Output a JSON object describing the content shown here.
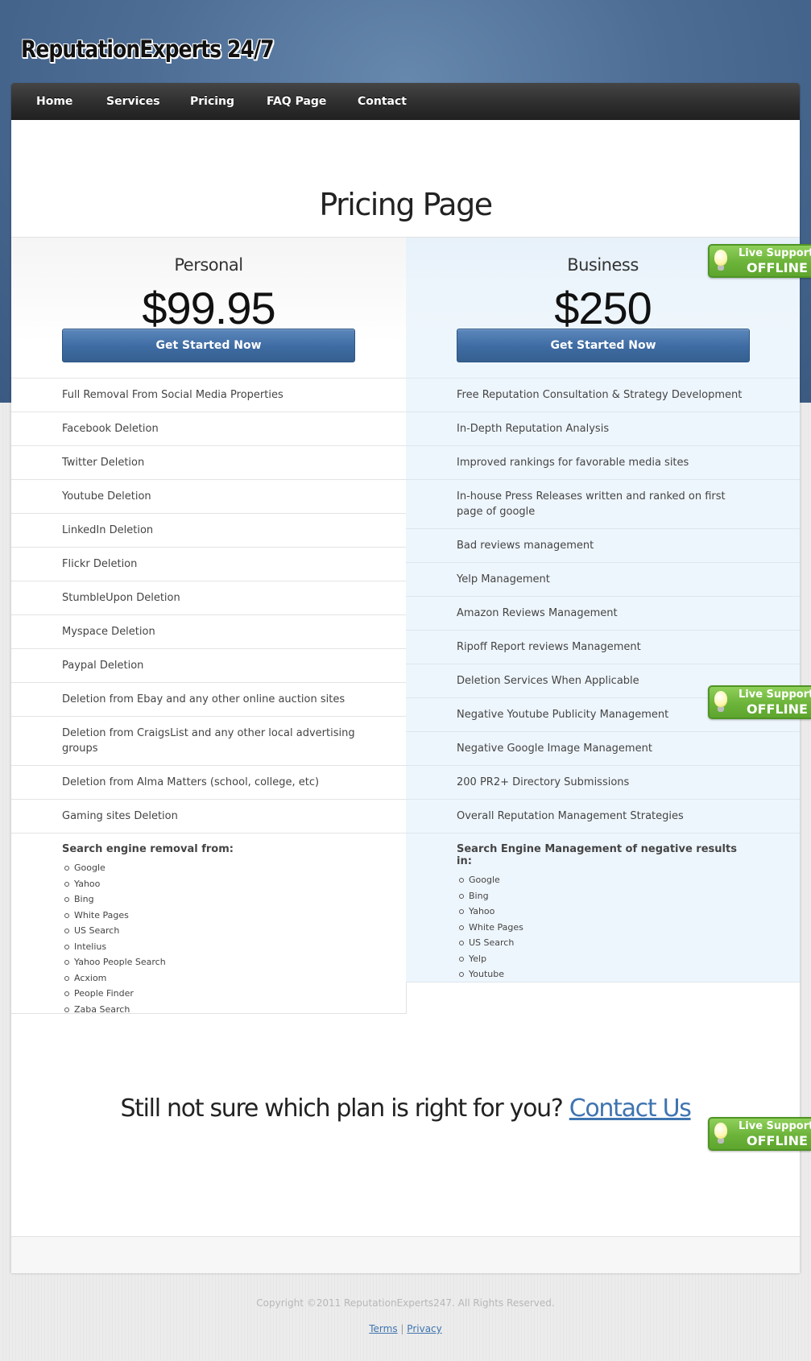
{
  "brand": {
    "logo_text": "ReputationExperts 24/7"
  },
  "nav": {
    "items": [
      {
        "label": "Home"
      },
      {
        "label": "Services"
      },
      {
        "label": "Pricing"
      },
      {
        "label": "FAQ Page"
      },
      {
        "label": "Contact"
      }
    ]
  },
  "page": {
    "title": "Pricing Page"
  },
  "plans": {
    "personal": {
      "name": "Personal",
      "price": "$99.95",
      "cta_label": "Get Started Now",
      "features": [
        "Full Removal From Social Media Properties",
        "Facebook Deletion",
        "Twitter Deletion",
        "Youtube Deletion",
        "LinkedIn Deletion",
        "Flickr Deletion",
        "StumbleUpon Deletion",
        "Myspace Deletion",
        "Paypal Deletion",
        "Deletion from Ebay and any other online auction sites",
        "Deletion from CraigsList and any other local advertising groups",
        "Deletion from Alma Matters (school, college, etc)",
        "Gaming sites Deletion"
      ],
      "engines_title": "Search engine removal from:",
      "engines": [
        "Google",
        "Yahoo",
        "Bing",
        "White Pages",
        "US Search",
        "Intelius",
        "Yahoo People Search",
        "Acxiom",
        "People Finder",
        "Zaba Search"
      ]
    },
    "business": {
      "name": "Business",
      "price": "$250",
      "cta_label": "Get Started Now",
      "features": [
        "Free Reputation Consultation & Strategy Development",
        "In-Depth Reputation Analysis",
        "Improved rankings for favorable media sites",
        "In-house Press Releases written and ranked on first page of google",
        "Bad reviews management",
        "Yelp Management",
        "Amazon Reviews Management",
        "Ripoff Report reviews Management",
        "Deletion Services When Applicable",
        "Negative Youtube Publicity Management",
        "Negative Google Image Management",
        "200 PR2+ Directory Submissions",
        "Overall Reputation Management Strategies"
      ],
      "engines_title": "Search Engine Management of negative results in:",
      "engines": [
        "Google",
        "Bing",
        "Yahoo",
        "White Pages",
        "US Search",
        "Yelp",
        "Youtube"
      ]
    }
  },
  "bottom_cta": {
    "text": "Still not sure which plan is right for you?",
    "link_label": "Contact Us"
  },
  "live_support": {
    "line1": "Live Support",
    "line2": "OFFLINE",
    "icon": "lightbulb-icon"
  },
  "footer": {
    "copyright": "Copyright ©2011 ReputationExperts247. All Rights Reserved.",
    "terms_label": "Terms",
    "separator": "|",
    "privacy_label": "Privacy"
  },
  "colors": {
    "header_blue": "#4d6d95",
    "nav_dark": "#2c2c2c",
    "button_blue": "#3e6ba2",
    "business_bg": "#eef6fd",
    "link_blue": "#3f74b0",
    "badge_green": "#6cb33a"
  }
}
